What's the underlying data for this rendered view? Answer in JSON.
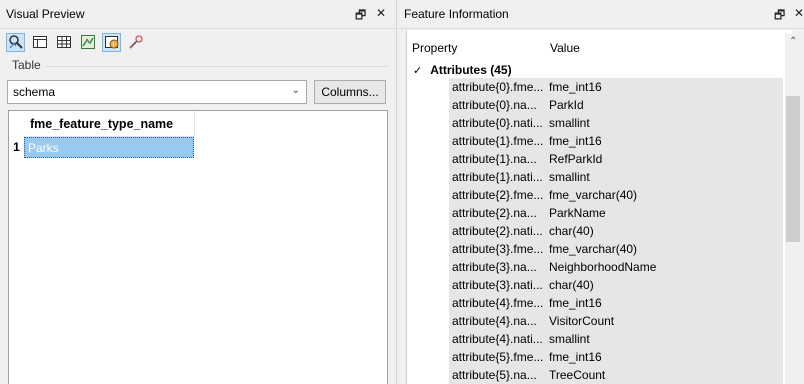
{
  "visual_preview": {
    "title": "Visual Preview",
    "pin_glyph": "🗗",
    "close_glyph": "✕",
    "toolbar": [
      {
        "name": "inspect-tool-icon",
        "active": true
      },
      {
        "name": "table-view-icon",
        "active": false
      },
      {
        "name": "grid-view-icon",
        "active": false
      },
      {
        "name": "graphics-view-icon",
        "active": false
      },
      {
        "name": "feature-info-icon",
        "active": true
      },
      {
        "name": "eyedropper-icon",
        "active": false
      }
    ],
    "table_section_label": "Table",
    "table_select_value": "schema",
    "columns_button_label": "Columns...",
    "table": {
      "header": "fme_feature_type_name",
      "rows": [
        {
          "num": "1",
          "value": "Parks"
        }
      ]
    }
  },
  "feature_information": {
    "title": "Feature Information",
    "pin_glyph": "🗗",
    "close_glyph": "✕",
    "col_property": "Property",
    "col_value": "Value",
    "group_label": "Attributes (45)",
    "attributes": [
      {
        "property": "attribute{0}.fme...",
        "value": "fme_int16"
      },
      {
        "property": "attribute{0}.na...",
        "value": "ParkId"
      },
      {
        "property": "attribute{0}.nati...",
        "value": "smallint"
      },
      {
        "property": "attribute{1}.fme...",
        "value": "fme_int16"
      },
      {
        "property": "attribute{1}.na...",
        "value": "RefParkId"
      },
      {
        "property": "attribute{1}.nati...",
        "value": "smallint"
      },
      {
        "property": "attribute{2}.fme...",
        "value": "fme_varchar(40)"
      },
      {
        "property": "attribute{2}.na...",
        "value": "ParkName"
      },
      {
        "property": "attribute{2}.nati...",
        "value": "char(40)"
      },
      {
        "property": "attribute{3}.fme...",
        "value": "fme_varchar(40)"
      },
      {
        "property": "attribute{3}.na...",
        "value": "NeighborhoodName"
      },
      {
        "property": "attribute{3}.nati...",
        "value": "char(40)"
      },
      {
        "property": "attribute{4}.fme...",
        "value": "fme_int16"
      },
      {
        "property": "attribute{4}.na...",
        "value": "VisitorCount"
      },
      {
        "property": "attribute{4}.nati...",
        "value": "smallint"
      },
      {
        "property": "attribute{5}.fme...",
        "value": "fme_int16"
      },
      {
        "property": "attribute{5}.na...",
        "value": "TreeCount"
      }
    ]
  }
}
